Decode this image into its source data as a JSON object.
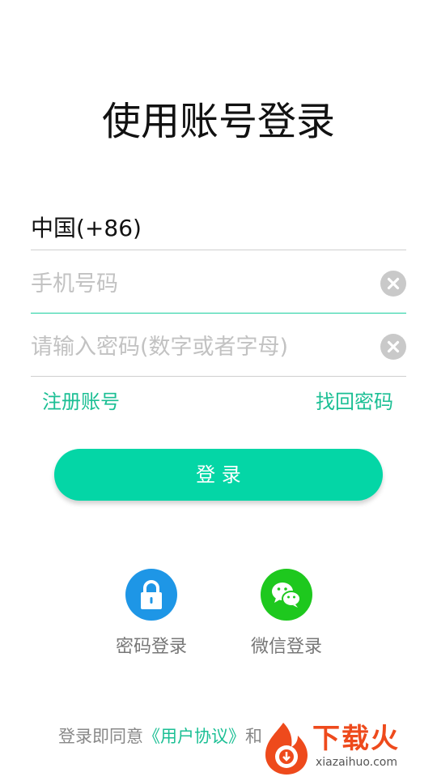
{
  "page": {
    "title": "使用账号登录"
  },
  "form": {
    "country_code": "中国(+86)",
    "phone_placeholder": "手机号码",
    "password_placeholder": "请输入密码(数字或者字母)"
  },
  "links": {
    "register": "注册账号",
    "recover": "找回密码"
  },
  "login_button": "登 录",
  "alt_login": [
    {
      "label": "密码登录",
      "icon": "lock-icon",
      "color": "#1e96e6"
    },
    {
      "label": "微信登录",
      "icon": "wechat-icon",
      "color": "#1ec81e"
    }
  ],
  "agreement": {
    "prefix": "登录即同意",
    "link": "《用户协议》",
    "suffix": "和"
  },
  "watermark": {
    "text": "下载火",
    "url": "xiazaihuo.com"
  },
  "colors": {
    "accent": "#04d6a6",
    "link": "#1bbf94",
    "lock_bg": "#1e96e6",
    "wechat_bg": "#1ec81e"
  }
}
